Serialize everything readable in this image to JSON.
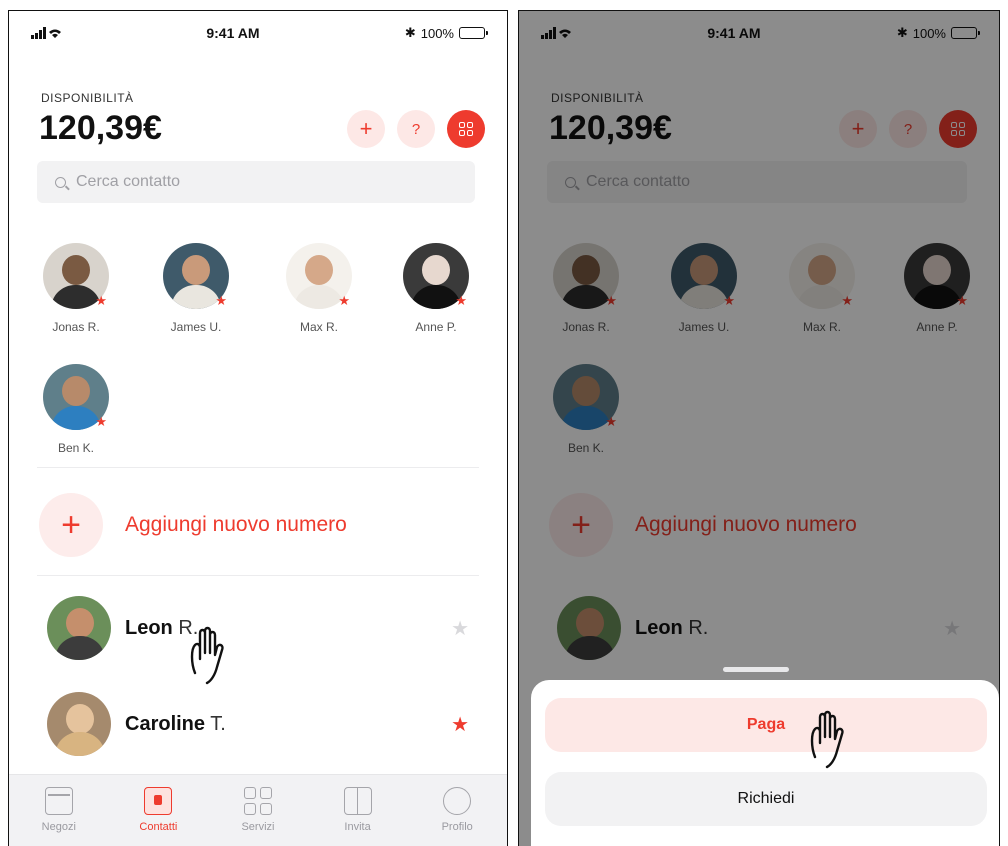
{
  "status": {
    "time": "9:41 AM",
    "battery": "100%"
  },
  "balance": {
    "label": "DISPONIBILITÀ",
    "amount": "120,39€"
  },
  "actions": {
    "add": "+",
    "help": "?"
  },
  "search": {
    "placeholder": "Cerca contatto"
  },
  "favorites": [
    {
      "name": "Jonas R."
    },
    {
      "name": "James U."
    },
    {
      "name": "Max R."
    },
    {
      "name": "Anne P."
    },
    {
      "name": "Ben K."
    }
  ],
  "add_number": {
    "icon": "+",
    "label": "Aggiungi nuovo numero"
  },
  "contacts": [
    {
      "first": "Leon",
      "last": "R.",
      "favorite": false
    },
    {
      "first": "Caroline",
      "last": "T.",
      "favorite": true
    }
  ],
  "tabs": [
    {
      "label": "Negozi",
      "icon": "store-icon",
      "active": false
    },
    {
      "label": "Contatti",
      "icon": "contacts-card-icon",
      "active": true
    },
    {
      "label": "Servizi",
      "icon": "grid-icon",
      "active": false
    },
    {
      "label": "Invita",
      "icon": "gift-icon",
      "active": false
    },
    {
      "label": "Profilo",
      "icon": "profile-icon",
      "active": false
    }
  ],
  "sheet": {
    "pay_label": "Paga",
    "request_label": "Richiedi"
  },
  "colors": {
    "accent": "#ee3b2e",
    "accent_soft": "#fde8e6",
    "muted": "#f2f2f3"
  }
}
